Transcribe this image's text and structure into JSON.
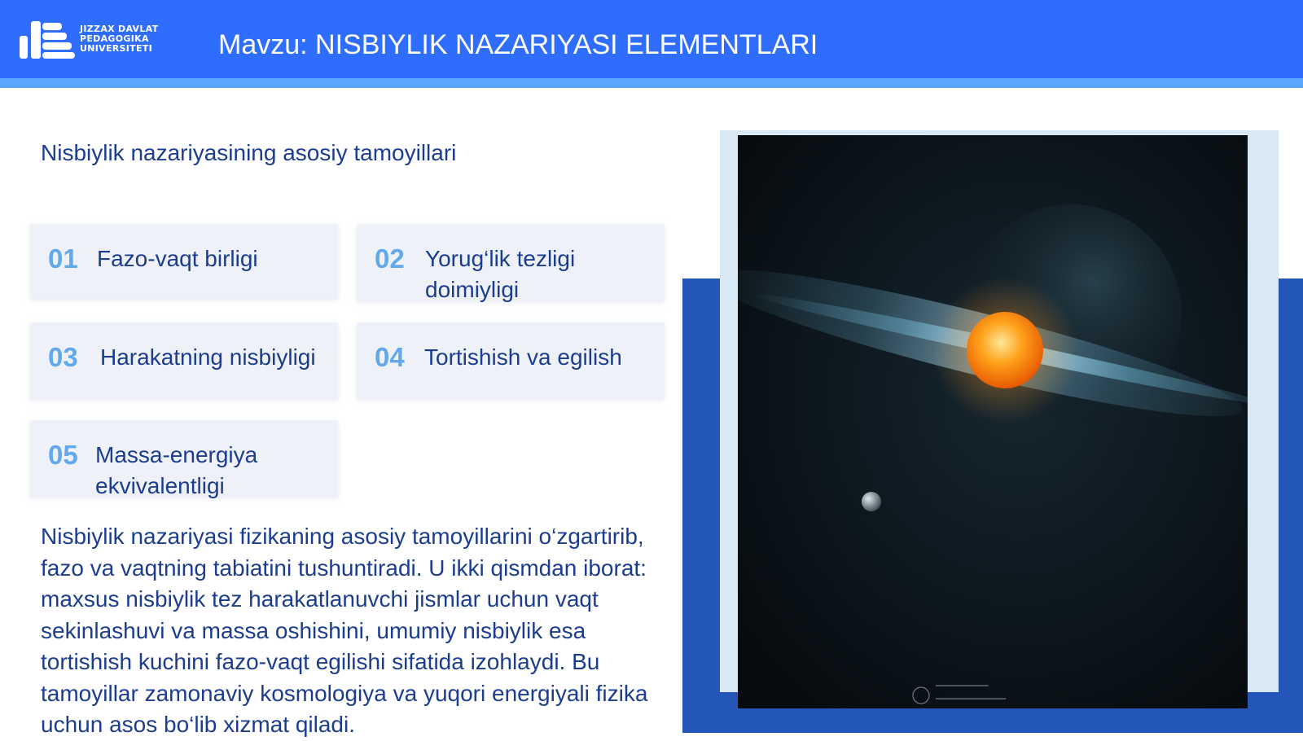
{
  "header": {
    "logo_lines": [
      "JIZZAX DAVLAT",
      "PEDAGOGIKA",
      "UNIVERSITETI"
    ],
    "title": "Mavzu: NISBIYLIK NAZARIYASI ELEMENTLARI"
  },
  "main": {
    "subtitle": "Nisbiylik nazariyasining asosiy tamoyillari",
    "cards": [
      {
        "number": "01",
        "label": "Fazo-vaqt birligi"
      },
      {
        "number": "02",
        "label": "Yorug‘lik tezligi doimiyligi"
      },
      {
        "number": "03",
        "label": "Harakatning nisbiyligi"
      },
      {
        "number": "04",
        "label": "Tortishish va egilish"
      },
      {
        "number": "05",
        "label": "Massa-energiya ekvivalentligi"
      }
    ],
    "paragraph": "Nisbiylik nazariyasi fizikaning asosiy tamoyillarini o‘zgartirib, fazo va vaqtning tabiatini tushuntiradi. U ikki qismdan iborat: maxsus nisbiylik tez harakatlanuvchi jismlar uchun vaqt sekinlashuvi va massa oshishini, umumiy nisbiylik esa tortishish kuchini fazo-vaqt egilishi sifatida izohlaydi. Bu tamoyillar zamonaviy kosmologiya va yuqori energiyali fizika uchun asos bo‘lib xizmat qiladi."
  },
  "colors": {
    "header_blue": "#2f6dff",
    "accent_blue": "#2456b9",
    "number_blue": "#62a9ec",
    "text_navy": "#1c3d8f"
  },
  "icons": {
    "logo": "university-logo-icon",
    "star": "sun-star-icon"
  }
}
